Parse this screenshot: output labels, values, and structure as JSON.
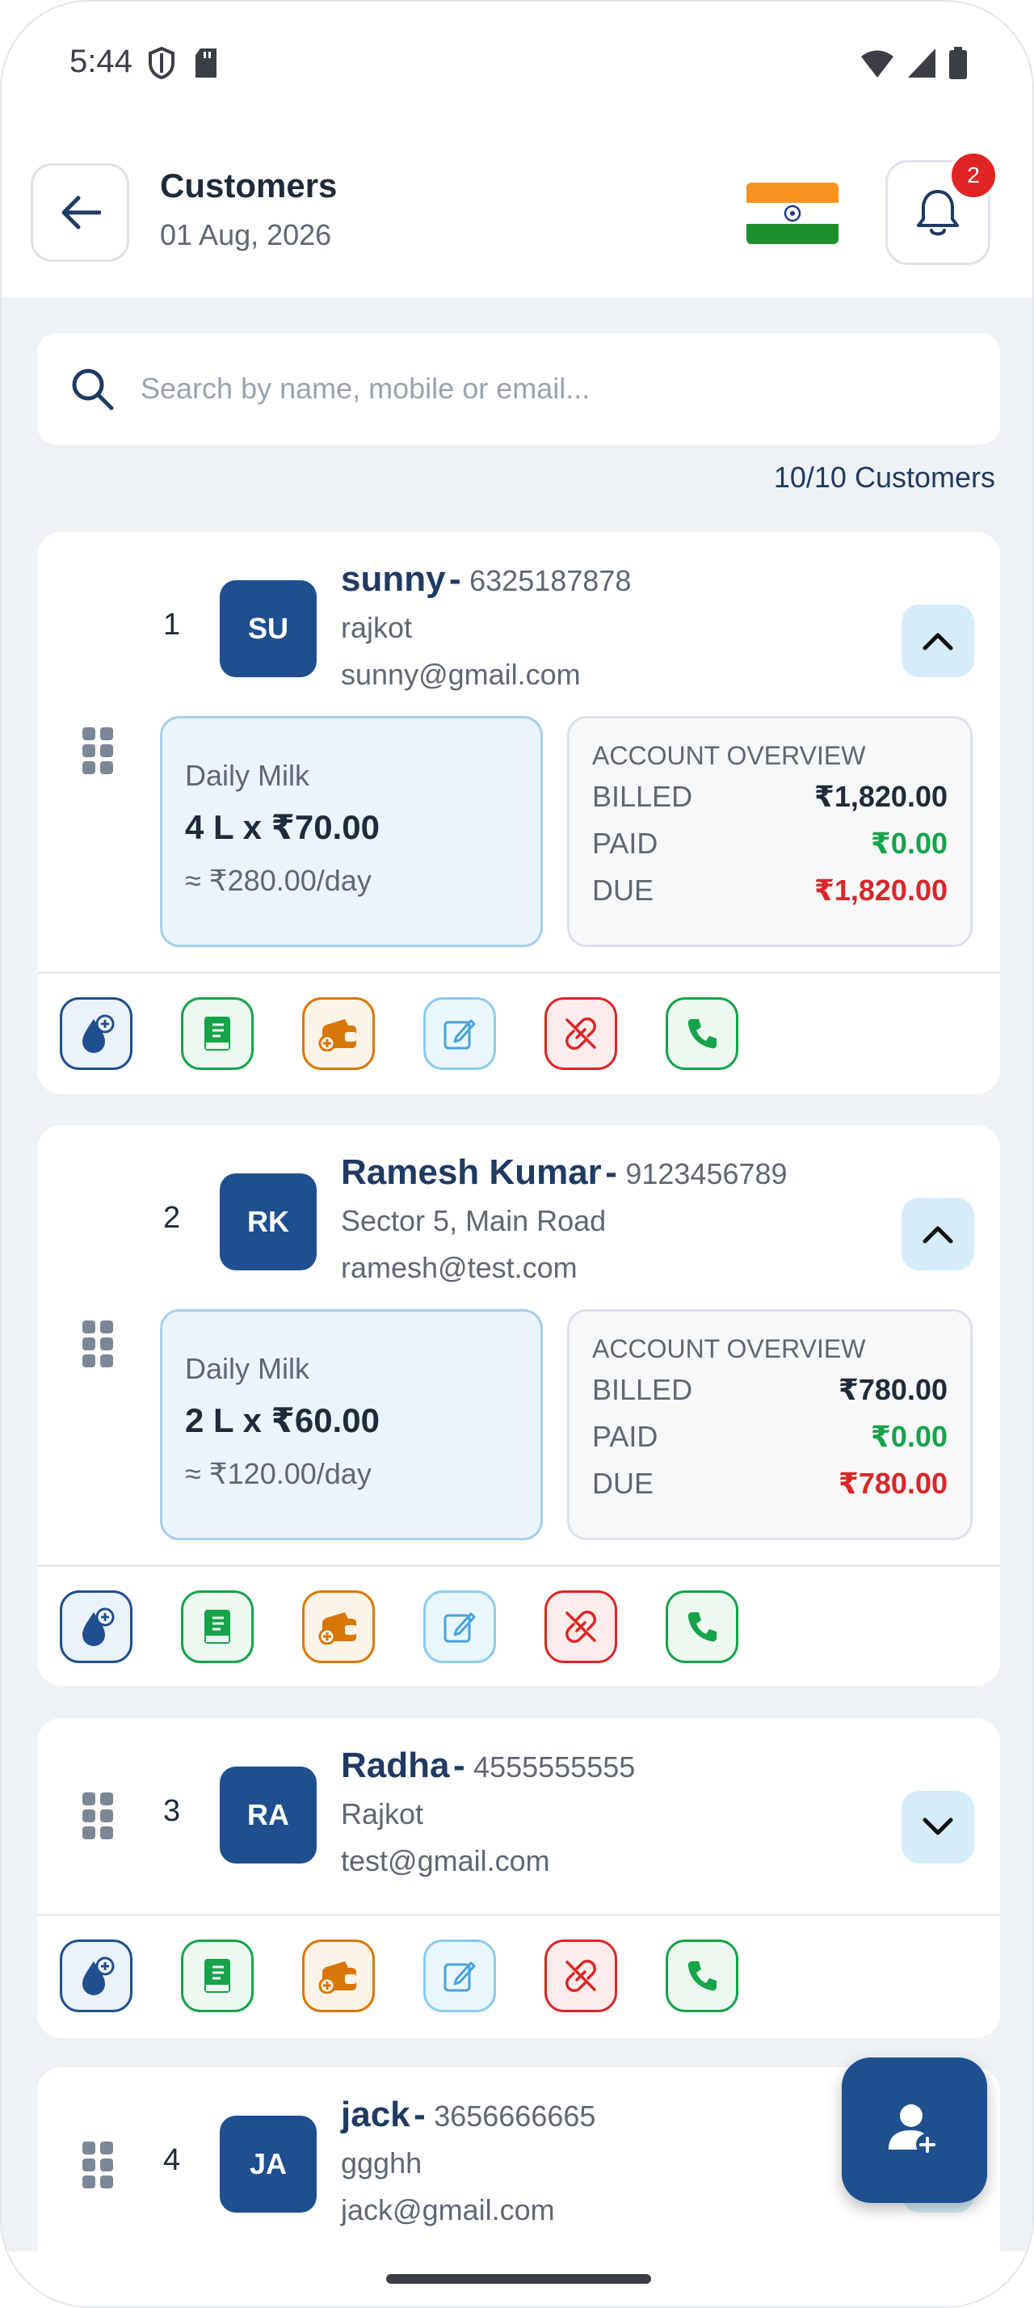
{
  "status_bar": {
    "time": "5:44",
    "left_icons": [
      "shield-icon",
      "sd-card-icon"
    ],
    "right_icons": [
      "wifi-icon",
      "signal-icon",
      "battery-icon"
    ]
  },
  "header": {
    "title": "Customers",
    "date": "01 Aug, 2026",
    "notification_count": "2",
    "flag": "india-flag"
  },
  "search": {
    "placeholder": "Search by name, mobile or email...",
    "value": ""
  },
  "customers_count": "10/10 Customers",
  "colors": {
    "primary": "#1f4f8f",
    "paid": "#16a34a",
    "due": "#dc2626",
    "badge": "#e02424"
  },
  "customers": [
    {
      "index": "1",
      "initials": "SU",
      "name": "sunny",
      "separator": "-",
      "phone": "6325187878",
      "address": "rajkot",
      "email": "sunny@gmail.com",
      "expanded": true,
      "daily_milk": {
        "label": "Daily Milk",
        "qty": "4 L x ₹70.00",
        "per_day": "≈ ₹280.00/day"
      },
      "account": {
        "title": "ACCOUNT OVERVIEW",
        "billed_label": "BILLED",
        "billed": "₹1,820.00",
        "paid_label": "PAID",
        "paid": "₹0.00",
        "due_label": "DUE",
        "due": "₹1,820.00"
      }
    },
    {
      "index": "2",
      "initials": "RK",
      "name": "Ramesh Kumar",
      "separator": "-",
      "phone": "9123456789",
      "address": "Sector 5, Main Road",
      "email": "ramesh@test.com",
      "expanded": true,
      "daily_milk": {
        "label": "Daily Milk",
        "qty": "2 L x ₹60.00",
        "per_day": "≈ ₹120.00/day"
      },
      "account": {
        "title": "ACCOUNT OVERVIEW",
        "billed_label": "BILLED",
        "billed": "₹780.00",
        "paid_label": "PAID",
        "paid": "₹0.00",
        "due_label": "DUE",
        "due": "₹780.00"
      }
    },
    {
      "index": "3",
      "initials": "RA",
      "name": "Radha",
      "separator": "-",
      "phone": "4555555555",
      "address": "Rajkot",
      "email": "test@gmail.com",
      "expanded": false
    },
    {
      "index": "4",
      "initials": "JA",
      "name": "jack",
      "separator": "-",
      "phone": "3656666665",
      "address": "ggghh",
      "email": "jack@gmail.com",
      "expanded": false
    }
  ],
  "card_actions": [
    "add-milk-icon",
    "ledger-icon",
    "wallet-add-icon",
    "edit-icon",
    "unlink-icon",
    "phone-icon"
  ],
  "fab": {
    "icon": "add-user-icon"
  }
}
